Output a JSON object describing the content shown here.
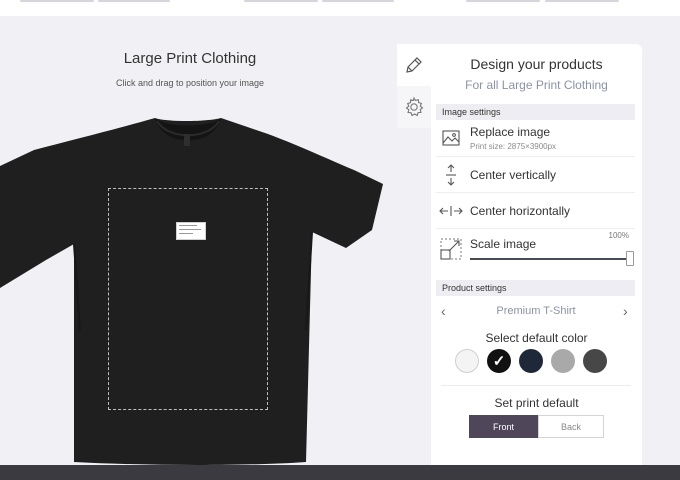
{
  "preview": {
    "title": "Large Print Clothing",
    "subtitle": "Click and drag to position your image"
  },
  "tabs": [
    {
      "name": "pencil-icon",
      "active": true
    },
    {
      "name": "gear-icon",
      "active": false
    }
  ],
  "panel": {
    "title": "Design your products",
    "subtitle": "For all Large Print Clothing"
  },
  "image_settings": {
    "header": "Image settings",
    "replace_label": "Replace image",
    "print_size": "Print size: 2875×3900px",
    "center_vertical_label": "Center vertically",
    "center_horizontal_label": "Center horizontally",
    "scale_label": "Scale image",
    "scale_value": "100%",
    "scale_level": 1.0
  },
  "product_settings": {
    "header": "Product settings",
    "product_name": "Premium T-Shirt",
    "prev_arrow": "‹",
    "next_arrow": "›",
    "color_title": "Select default color",
    "colors": [
      {
        "name": "white",
        "hex": "#f4f4f4",
        "selected": false
      },
      {
        "name": "black",
        "hex": "#111111",
        "selected": true
      },
      {
        "name": "navy",
        "hex": "#1e2838",
        "selected": false
      },
      {
        "name": "heather-grey",
        "hex": "#a9a9a9",
        "selected": false
      },
      {
        "name": "charcoal",
        "hex": "#474747",
        "selected": false
      }
    ],
    "check_glyph": "✓",
    "print_title": "Set print default",
    "front_label": "Front",
    "back_label": "Back",
    "selected_print": "Front"
  },
  "colors": {
    "accent": "#4f4659",
    "shirt": "#1f1f1f",
    "muted_text": "#8a93a6"
  }
}
